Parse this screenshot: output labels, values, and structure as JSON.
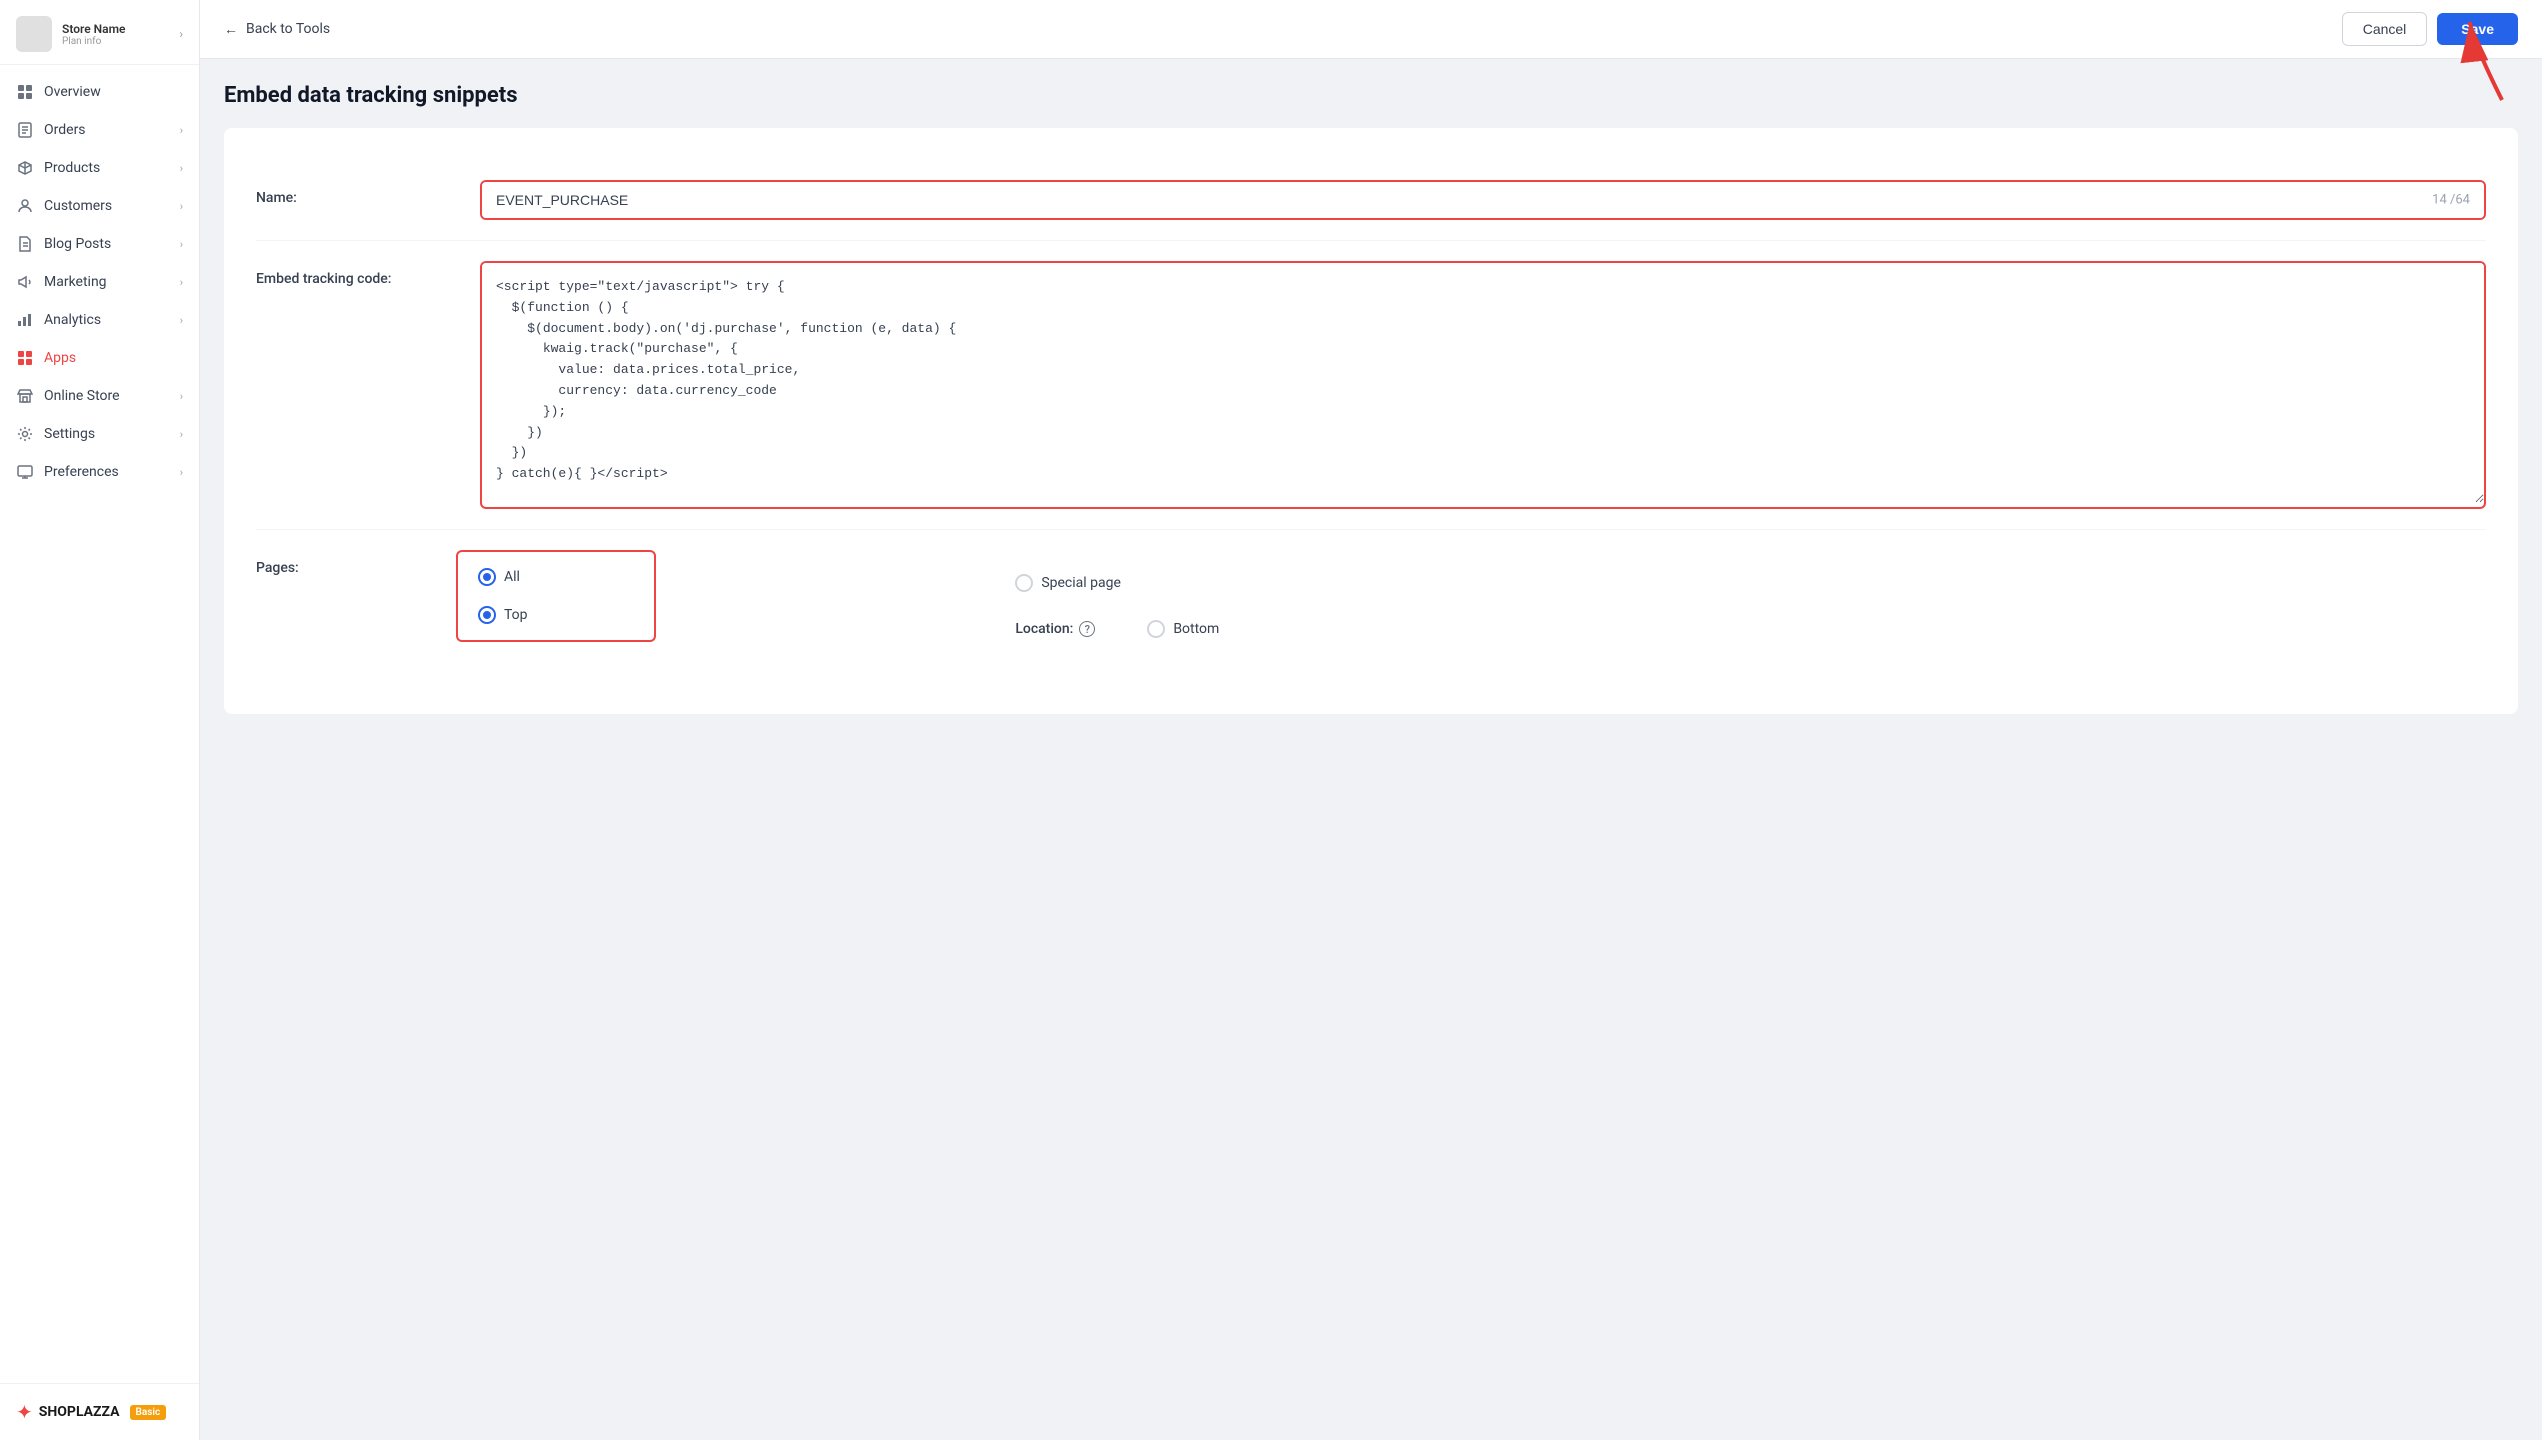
{
  "sidebar": {
    "logo": {
      "title": "Store Name",
      "subtitle": "Plan info"
    },
    "items": [
      {
        "id": "overview",
        "label": "Overview",
        "icon": "grid",
        "hasChevron": false,
        "active": false
      },
      {
        "id": "orders",
        "label": "Orders",
        "icon": "receipt",
        "hasChevron": true,
        "active": false
      },
      {
        "id": "products",
        "label": "Products",
        "icon": "box",
        "hasChevron": true,
        "active": false
      },
      {
        "id": "customers",
        "label": "Customers",
        "icon": "person",
        "hasChevron": true,
        "active": false
      },
      {
        "id": "blog-posts",
        "label": "Blog Posts",
        "icon": "file",
        "hasChevron": true,
        "active": false
      },
      {
        "id": "marketing",
        "label": "Marketing",
        "icon": "megaphone",
        "hasChevron": true,
        "active": false
      },
      {
        "id": "analytics",
        "label": "Analytics",
        "icon": "chart",
        "hasChevron": true,
        "active": false
      },
      {
        "id": "apps",
        "label": "Apps",
        "icon": "apps",
        "hasChevron": false,
        "active": true
      },
      {
        "id": "online-store",
        "label": "Online Store",
        "icon": "store",
        "hasChevron": true,
        "active": false
      },
      {
        "id": "settings",
        "label": "Settings",
        "icon": "gear",
        "hasChevron": true,
        "active": false
      },
      {
        "id": "preferences",
        "label": "Preferences",
        "icon": "monitor",
        "hasChevron": true,
        "active": false
      }
    ],
    "footer": {
      "brand": "SHOPLAZZA",
      "badge": "Basic"
    }
  },
  "topbar": {
    "back_label": "Back to Tools",
    "cancel_label": "Cancel",
    "save_label": "Save"
  },
  "page": {
    "title": "Embed data tracking snippets"
  },
  "form": {
    "name_label": "Name:",
    "name_value": "EVENT_PURCHASE",
    "name_counter": "14 /64",
    "code_label": "Embed tracking code:",
    "code_value": "<script type=\"text/javascript\"> try {\n  $(function () {\n    $(document.body).on('dj.purchase', function (e, data) {\n      kwaig.track(\"purchase\", {\n        value: data.prices.total_price,\n        currency: data.currency_code\n      });\n    })\n  })\n} catch(e){ }</script>",
    "pages_label": "Pages:",
    "location_label": "Location:",
    "pages_options": [
      {
        "id": "all",
        "label": "All",
        "checked": true
      },
      {
        "id": "special-page",
        "label": "Special page",
        "checked": false
      }
    ],
    "location_options": [
      {
        "id": "top",
        "label": "Top",
        "checked": true
      },
      {
        "id": "bottom",
        "label": "Bottom",
        "checked": false
      }
    ]
  }
}
